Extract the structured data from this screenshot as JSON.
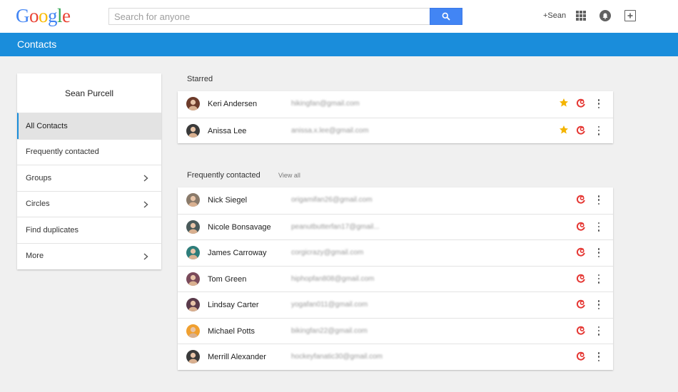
{
  "logo": {
    "letters": [
      "G",
      "o",
      "o",
      "g",
      "l",
      "e"
    ],
    "colors": [
      "#4285f4",
      "#ea4335",
      "#fbbc05",
      "#4285f4",
      "#34a853",
      "#ea4335"
    ]
  },
  "search": {
    "placeholder": "Search for anyone"
  },
  "header": {
    "plus_name": "+Sean"
  },
  "appbar": {
    "title": "Contacts",
    "color": "#1a8ddb"
  },
  "sidebar": {
    "user_name": "Sean Purcell",
    "items": [
      {
        "label": "All Contacts",
        "active": true,
        "has_chevron": false
      },
      {
        "label": "Frequently contacted",
        "active": false,
        "has_chevron": false
      },
      {
        "label": "Groups",
        "active": false,
        "has_chevron": true
      },
      {
        "label": "Circles",
        "active": false,
        "has_chevron": true
      },
      {
        "label": "Find duplicates",
        "active": false,
        "has_chevron": false
      },
      {
        "label": "More",
        "active": false,
        "has_chevron": true
      }
    ]
  },
  "starred": {
    "label": "Starred",
    "contacts": [
      {
        "name": "Keri Andersen",
        "email": "hikingfan@gmail.com",
        "avatar_color": "#6d3b2a"
      },
      {
        "name": "Anissa Lee",
        "email": "anissa.x.lee@gmail.com",
        "avatar_color": "#3a3a3a"
      }
    ]
  },
  "frequent": {
    "label": "Frequently contacted",
    "view_all": "View all",
    "contacts": [
      {
        "name": "Nick Siegel",
        "email": "origamifan26@gmail.com",
        "avatar_color": "#8a7a6a"
      },
      {
        "name": "Nicole Bonsavage",
        "email": "peanutbutterfan17@gmail...",
        "avatar_color": "#4a5a5a"
      },
      {
        "name": "James Carroway",
        "email": "corgicrazy@gmail.com",
        "avatar_color": "#2e7d7a"
      },
      {
        "name": "Tom Green",
        "email": "hiphopfan808@gmail.com",
        "avatar_color": "#7a4a5a"
      },
      {
        "name": "Lindsay Carter",
        "email": "yogafan011@gmail.com",
        "avatar_color": "#5a3a4a"
      },
      {
        "name": "Michael Potts",
        "email": "bikingfan22@gmail.com",
        "avatar_color": "#f0a030"
      },
      {
        "name": "Merrill Alexander",
        "email": "hockeyfanatic30@gmail.com",
        "avatar_color": "#3a3a3a"
      }
    ]
  },
  "icons": {
    "star": "star-icon",
    "hangout": "hangout-icon",
    "more": "more-vert-icon"
  },
  "colors": {
    "star": "#f4b400",
    "hangout": "#e53935",
    "search_button": "#4285f4"
  }
}
